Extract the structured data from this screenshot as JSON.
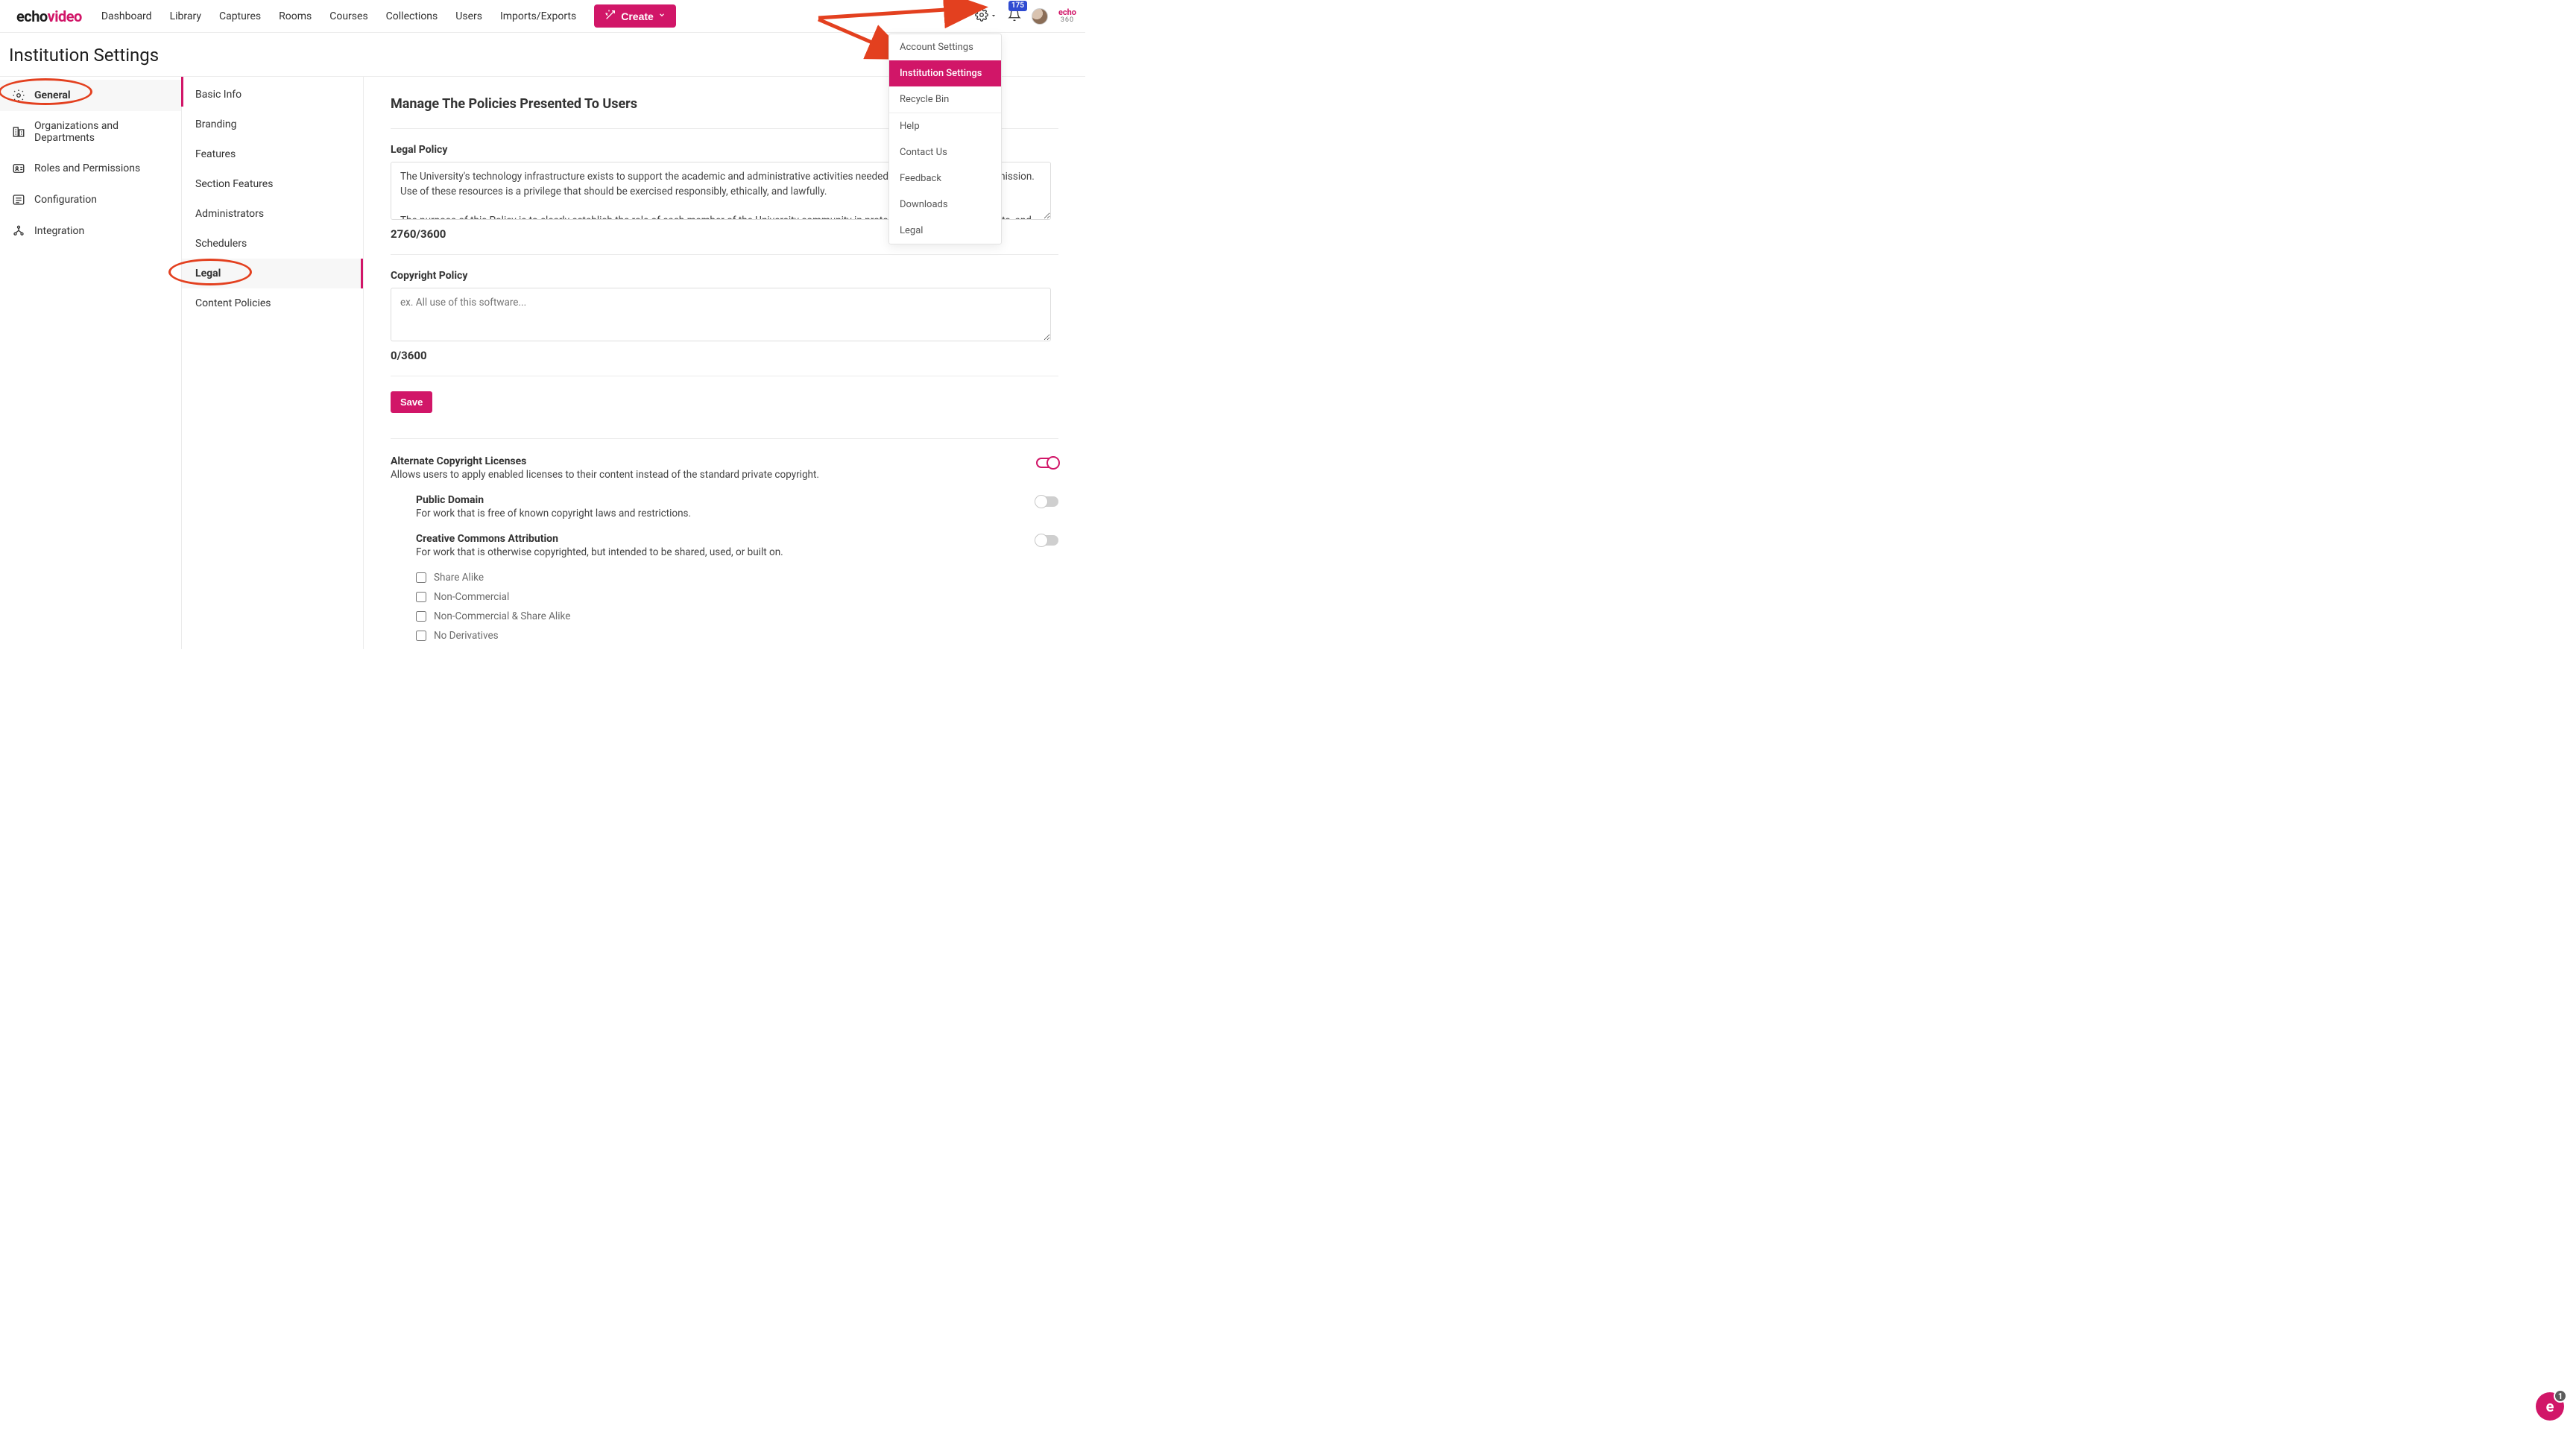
{
  "brand": {
    "part1": "echo",
    "part2": "video",
    "small_top": "echo",
    "small_bottom": "360"
  },
  "nav": [
    "Dashboard",
    "Library",
    "Captures",
    "Rooms",
    "Courses",
    "Collections",
    "Users",
    "Imports/Exports"
  ],
  "create_label": "Create",
  "notifications_count": "175",
  "settings_menu": {
    "items": [
      "Account Settings",
      "Institution Settings",
      "Recycle Bin",
      "Help",
      "Contact Us",
      "Feedback",
      "Downloads",
      "Legal"
    ],
    "selected": "Institution Settings"
  },
  "page_title": "Institution Settings",
  "primary_nav": [
    {
      "label": "General",
      "icon": "gear",
      "selected": true
    },
    {
      "label": "Organizations and Departments",
      "icon": "org"
    },
    {
      "label": "Roles and Permissions",
      "icon": "idcard"
    },
    {
      "label": "Configuration",
      "icon": "list"
    },
    {
      "label": "Integration",
      "icon": "nodes"
    }
  ],
  "secondary_nav": [
    {
      "label": "Basic Info"
    },
    {
      "label": "Branding"
    },
    {
      "label": "Features"
    },
    {
      "label": "Section Features"
    },
    {
      "label": "Administrators"
    },
    {
      "label": "Schedulers"
    },
    {
      "label": "Legal",
      "selected": true
    },
    {
      "label": "Content Policies"
    }
  ],
  "content": {
    "heading": "Manage The Policies Presented To Users",
    "legal_label": "Legal Policy",
    "legal_value": "The University's technology infrastructure exists to support the academic and administrative activities needed to fulfill the University's mission. Use of these resources is a privilege that should be exercised responsibly, ethically, and lawfully.\n\nThe purpose of this Policy is to clearly establish the role of each member of the University community in protecting its information assets, and to articulate baseline expectations for meeting these requirements. Fulfilling these objectives will enable the University to implement a comprehensive system of internal controls with minimum",
    "legal_counter": "2760/3600",
    "copyright_label": "Copyright Policy",
    "copyright_placeholder": "ex. All use of this software...",
    "copyright_counter": "0/3600",
    "save_label": "Save",
    "alt_head": "Alternate Copyright Licenses",
    "alt_desc": "Allows users to apply enabled licenses to their content instead of the standard private copyright.",
    "pd_head": "Public Domain",
    "pd_desc": "For work that is free of known copyright laws and restrictions.",
    "cca_head": "Creative Commons Attribution",
    "cca_desc": "For work that is otherwise copyrighted, but intended to be shared, used, or built on.",
    "cc_options": [
      "Share Alike",
      "Non-Commercial",
      "Non-Commercial & Share Alike",
      "No Derivatives"
    ]
  },
  "chat_badge": "1"
}
